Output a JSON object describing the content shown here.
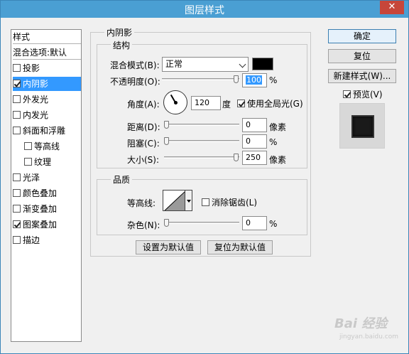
{
  "window": {
    "title": "图层样式",
    "close_label": "✕"
  },
  "sidebar": {
    "header": "样式",
    "blend_options": "混合选项:默认",
    "items": [
      {
        "label": "投影",
        "checked": false,
        "selected": false
      },
      {
        "label": "内阴影",
        "checked": true,
        "selected": true
      },
      {
        "label": "外发光",
        "checked": false,
        "selected": false
      },
      {
        "label": "内发光",
        "checked": false,
        "selected": false
      },
      {
        "label": "斜面和浮雕",
        "checked": false,
        "selected": false
      },
      {
        "label": "等高线",
        "checked": false,
        "selected": false
      },
      {
        "label": "纹理",
        "checked": false,
        "selected": false
      },
      {
        "label": "光泽",
        "checked": false,
        "selected": false
      },
      {
        "label": "颜色叠加",
        "checked": false,
        "selected": false
      },
      {
        "label": "渐变叠加",
        "checked": false,
        "selected": false
      },
      {
        "label": "图案叠加",
        "checked": true,
        "selected": false
      },
      {
        "label": "描边",
        "checked": false,
        "selected": false
      }
    ]
  },
  "panel": {
    "title": "内阴影",
    "structure": {
      "title": "结构",
      "blend_mode_label": "混合模式(B):",
      "blend_mode_value": "正常",
      "shadow_color": "#000000",
      "opacity_label": "不透明度(O):",
      "opacity_value": "100",
      "opacity_unit": "%",
      "opacity_level": 1.0,
      "angle_label": "角度(A):",
      "angle_value": "120",
      "angle_unit": "度",
      "global_light_label": "使用全局光(G)",
      "global_light_checked": true,
      "distance_label": "距离(D):",
      "distance_value": "0",
      "distance_unit": "像素",
      "distance_level": 0,
      "choke_label": "阻塞(C):",
      "choke_value": "0",
      "choke_unit": "%",
      "choke_level": 0,
      "size_label": "大小(S):",
      "size_value": "250",
      "size_unit": "像素",
      "size_level": 1.0
    },
    "quality": {
      "title": "品质",
      "contour_label": "等高线:",
      "antialias_label": "消除锯齿(L)",
      "antialias_checked": false,
      "noise_label": "杂色(N):",
      "noise_value": "0",
      "noise_unit": "%",
      "noise_level": 0
    },
    "make_default_label": "设置为默认值",
    "reset_default_label": "复位为默认值"
  },
  "actions": {
    "ok_label": "确定",
    "reset_label": "复位",
    "new_style_label": "新建样式(W)...",
    "preview_label": "预览(V)",
    "preview_checked": true
  },
  "watermark": {
    "brand": "Bai 经验",
    "url": "jingyan.baidu.com"
  }
}
